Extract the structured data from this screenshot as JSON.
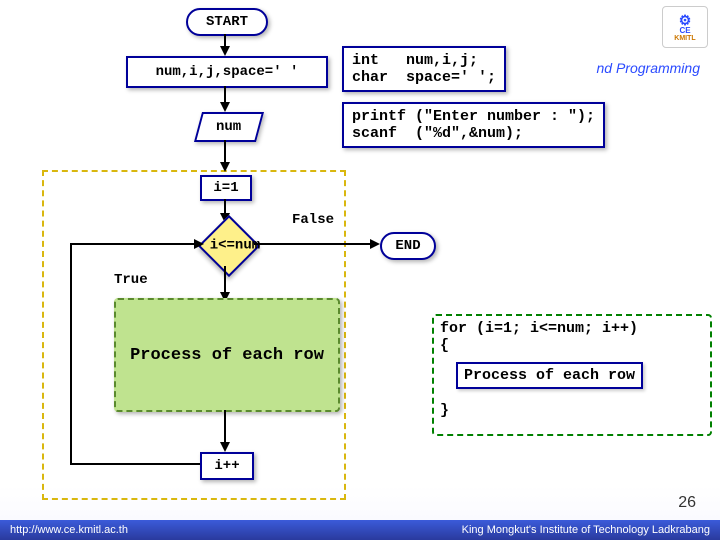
{
  "logo": {
    "top": "CE",
    "bottom": "KMITL"
  },
  "header_suffix": "nd Programming",
  "footer": {
    "left": "http://www.ce.kmitl.ac.th",
    "right": "King Mongkut's Institute of Technology Ladkrabang"
  },
  "page_number": "26",
  "flow": {
    "start": "START",
    "declare": "num,i,j,space=' '",
    "input_num": "num",
    "init_i": "i=1",
    "cond": "i<=num",
    "cond_false": "False",
    "cond_true": "True",
    "end": "END",
    "process_row": "Process of each row",
    "incr": "i++"
  },
  "code": {
    "decl": "int   num,i,j;\nchar  space=' ';",
    "io": "printf (\"Enter number : \");\nscanf  (\"%d\",&num);",
    "loop_open": "for (i=1; i<=num; i++)\n{",
    "loop_body": "Process of each row",
    "loop_close": "}"
  },
  "chart_data": {
    "type": "flowchart",
    "nodes": [
      {
        "id": "start",
        "kind": "terminator",
        "label": "START"
      },
      {
        "id": "decl",
        "kind": "process",
        "label": "num,i,j,space=' '",
        "code": "int num,i,j;\nchar space=' ';"
      },
      {
        "id": "input",
        "kind": "io",
        "label": "num",
        "code": "printf(\"Enter number : \");\nscanf(\"%d\",&num);"
      },
      {
        "id": "init",
        "kind": "process",
        "label": "i=1"
      },
      {
        "id": "cond",
        "kind": "decision",
        "label": "i<=num"
      },
      {
        "id": "body",
        "kind": "process",
        "label": "Process of each row"
      },
      {
        "id": "incr",
        "kind": "process",
        "label": "i++"
      },
      {
        "id": "end",
        "kind": "terminator",
        "label": "END"
      }
    ],
    "edges": [
      {
        "from": "start",
        "to": "decl"
      },
      {
        "from": "decl",
        "to": "input"
      },
      {
        "from": "input",
        "to": "init"
      },
      {
        "from": "init",
        "to": "cond"
      },
      {
        "from": "cond",
        "to": "body",
        "label": "True"
      },
      {
        "from": "body",
        "to": "incr"
      },
      {
        "from": "incr",
        "to": "cond"
      },
      {
        "from": "cond",
        "to": "end",
        "label": "False"
      }
    ],
    "loop_group": [
      "init",
      "cond",
      "body",
      "incr"
    ],
    "loop_code": "for (i=1; i<=num; i++) { Process of each row }"
  }
}
